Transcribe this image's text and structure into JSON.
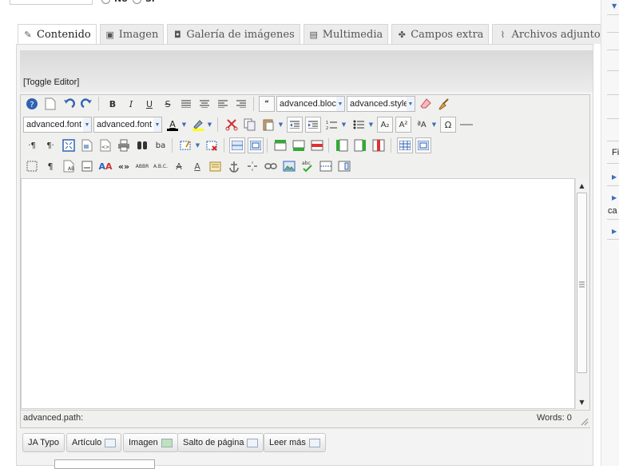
{
  "top_options": {
    "no": "No",
    "si": "Sí"
  },
  "tabs": [
    {
      "label": "Contenido",
      "icon": "edit-icon",
      "active": true
    },
    {
      "label": "Imagen",
      "icon": "image-icon"
    },
    {
      "label": "Galería de imágenes",
      "icon": "camera-icon"
    },
    {
      "label": "Multimedia",
      "icon": "film-icon"
    },
    {
      "label": "Campos extra",
      "icon": "puzzle-icon"
    },
    {
      "label": "Archivos adjuntos",
      "icon": "paperclip-icon"
    }
  ],
  "editor": {
    "toggle_label": "[Toggle Editor]",
    "block_format": "advanced.bloc",
    "style_select": "advanced.style",
    "font_family": "advanced.font",
    "font_size": "advanced.font",
    "path_label": "advanced.path:",
    "words_label": "Words: 0"
  },
  "buttons": [
    {
      "label": "JA Typo"
    },
    {
      "label": "Artículo"
    },
    {
      "label": "Imagen"
    },
    {
      "label": "Salto de página"
    },
    {
      "label": "Leer más"
    }
  ],
  "sidebar": {
    "fi_label": "Fi",
    "ca_label": "ca"
  },
  "colors": {
    "accent": "#3b6fb6"
  }
}
